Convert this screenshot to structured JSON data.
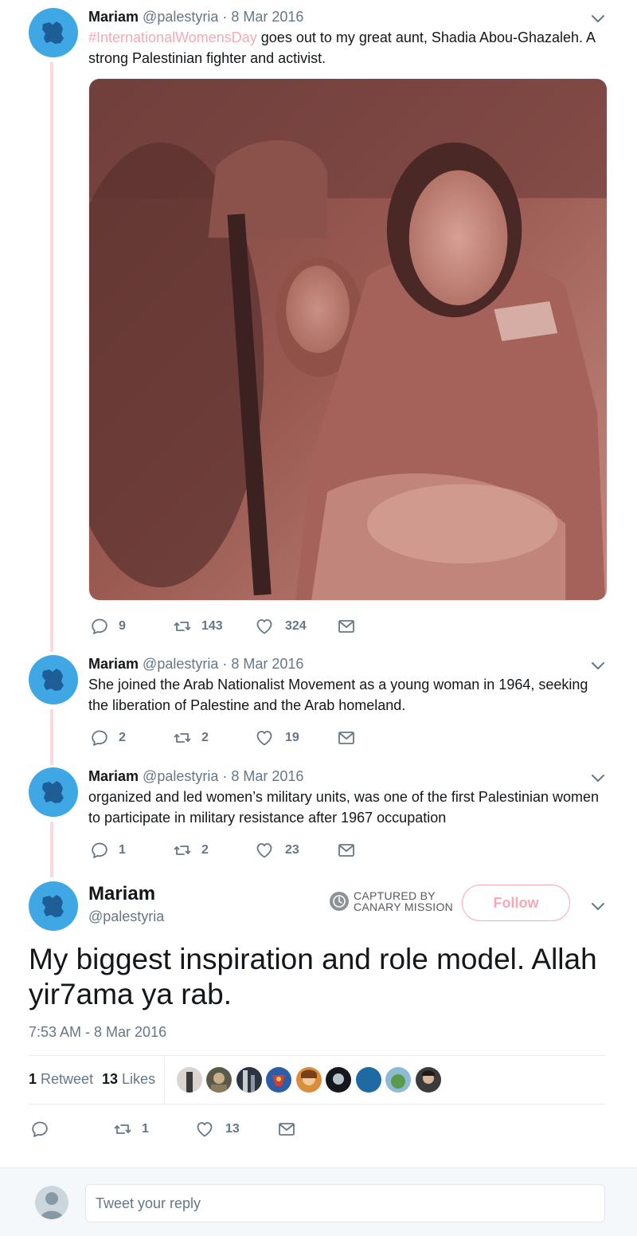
{
  "thread": [
    {
      "name": "Mariam",
      "handle": "@palestyria",
      "date": "· 8 Mar 2016",
      "hashtag": "#InternationalWomensDay",
      "text": " goes out to my great aunt, Shadia Abou-Ghazaleh. A strong Palestinian fighter and activist.",
      "replies": "9",
      "retweets": "143",
      "likes": "324"
    },
    {
      "name": "Mariam",
      "handle": "@palestyria",
      "date": "· 8 Mar 2016",
      "text": "She joined the Arab Nationalist Movement as a young woman in 1964, seeking the liberation of Palestine and the Arab homeland.",
      "replies": "2",
      "retweets": "2",
      "likes": "19"
    },
    {
      "name": "Mariam",
      "handle": "@palestyria",
      "date": "· 8 Mar 2016",
      "text": "organized and led women’s military units, was one of the first Palestinian women to participate in military resistance after 1967 occupation",
      "replies": "1",
      "retweets": "2",
      "likes": "23"
    }
  ],
  "main": {
    "name": "Mariam",
    "handle": "@palestyria",
    "watermark_line1": "CAPTURED BY",
    "watermark_line2": "CANARY MISSION",
    "follow_label": "Follow",
    "text": "My biggest inspiration and role model. Allah yir7ama ya rab.",
    "timestamp": "7:53 AM - 8 Mar 2016",
    "retweet_count": "1",
    "retweet_label": "Retweet",
    "like_count": "13",
    "like_label": "Likes",
    "action_retweets": "1",
    "action_likes": "13"
  },
  "reply": {
    "placeholder": "Tweet your reply"
  },
  "colors": {
    "accent": "#f7a8b6",
    "avatar": "#3fa7e4",
    "thread_line": "#fbd8dc",
    "muted": "#657786"
  }
}
